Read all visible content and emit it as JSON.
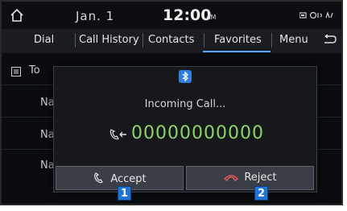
{
  "status": {
    "date": "Jan.  1",
    "time": "12:00",
    "ampm": "AM"
  },
  "tabs": [
    {
      "label": "Dial"
    },
    {
      "label": "Call History"
    },
    {
      "label": "Contacts"
    },
    {
      "label": "Favorites",
      "active": true
    },
    {
      "label": "Menu"
    }
  ],
  "background_list": {
    "header": "To",
    "rows": [
      "Na",
      "Na",
      "Na"
    ]
  },
  "popup": {
    "title": "Incoming Call...",
    "number": "00000000000",
    "accept_label": "Accept",
    "reject_label": "Reject"
  },
  "callouts": [
    "1",
    "2"
  ],
  "colors": {
    "accent": "#5aa6ff",
    "number": "#8ed36a",
    "callout": "#1f74d6",
    "reject_icon": "#e0565b"
  }
}
